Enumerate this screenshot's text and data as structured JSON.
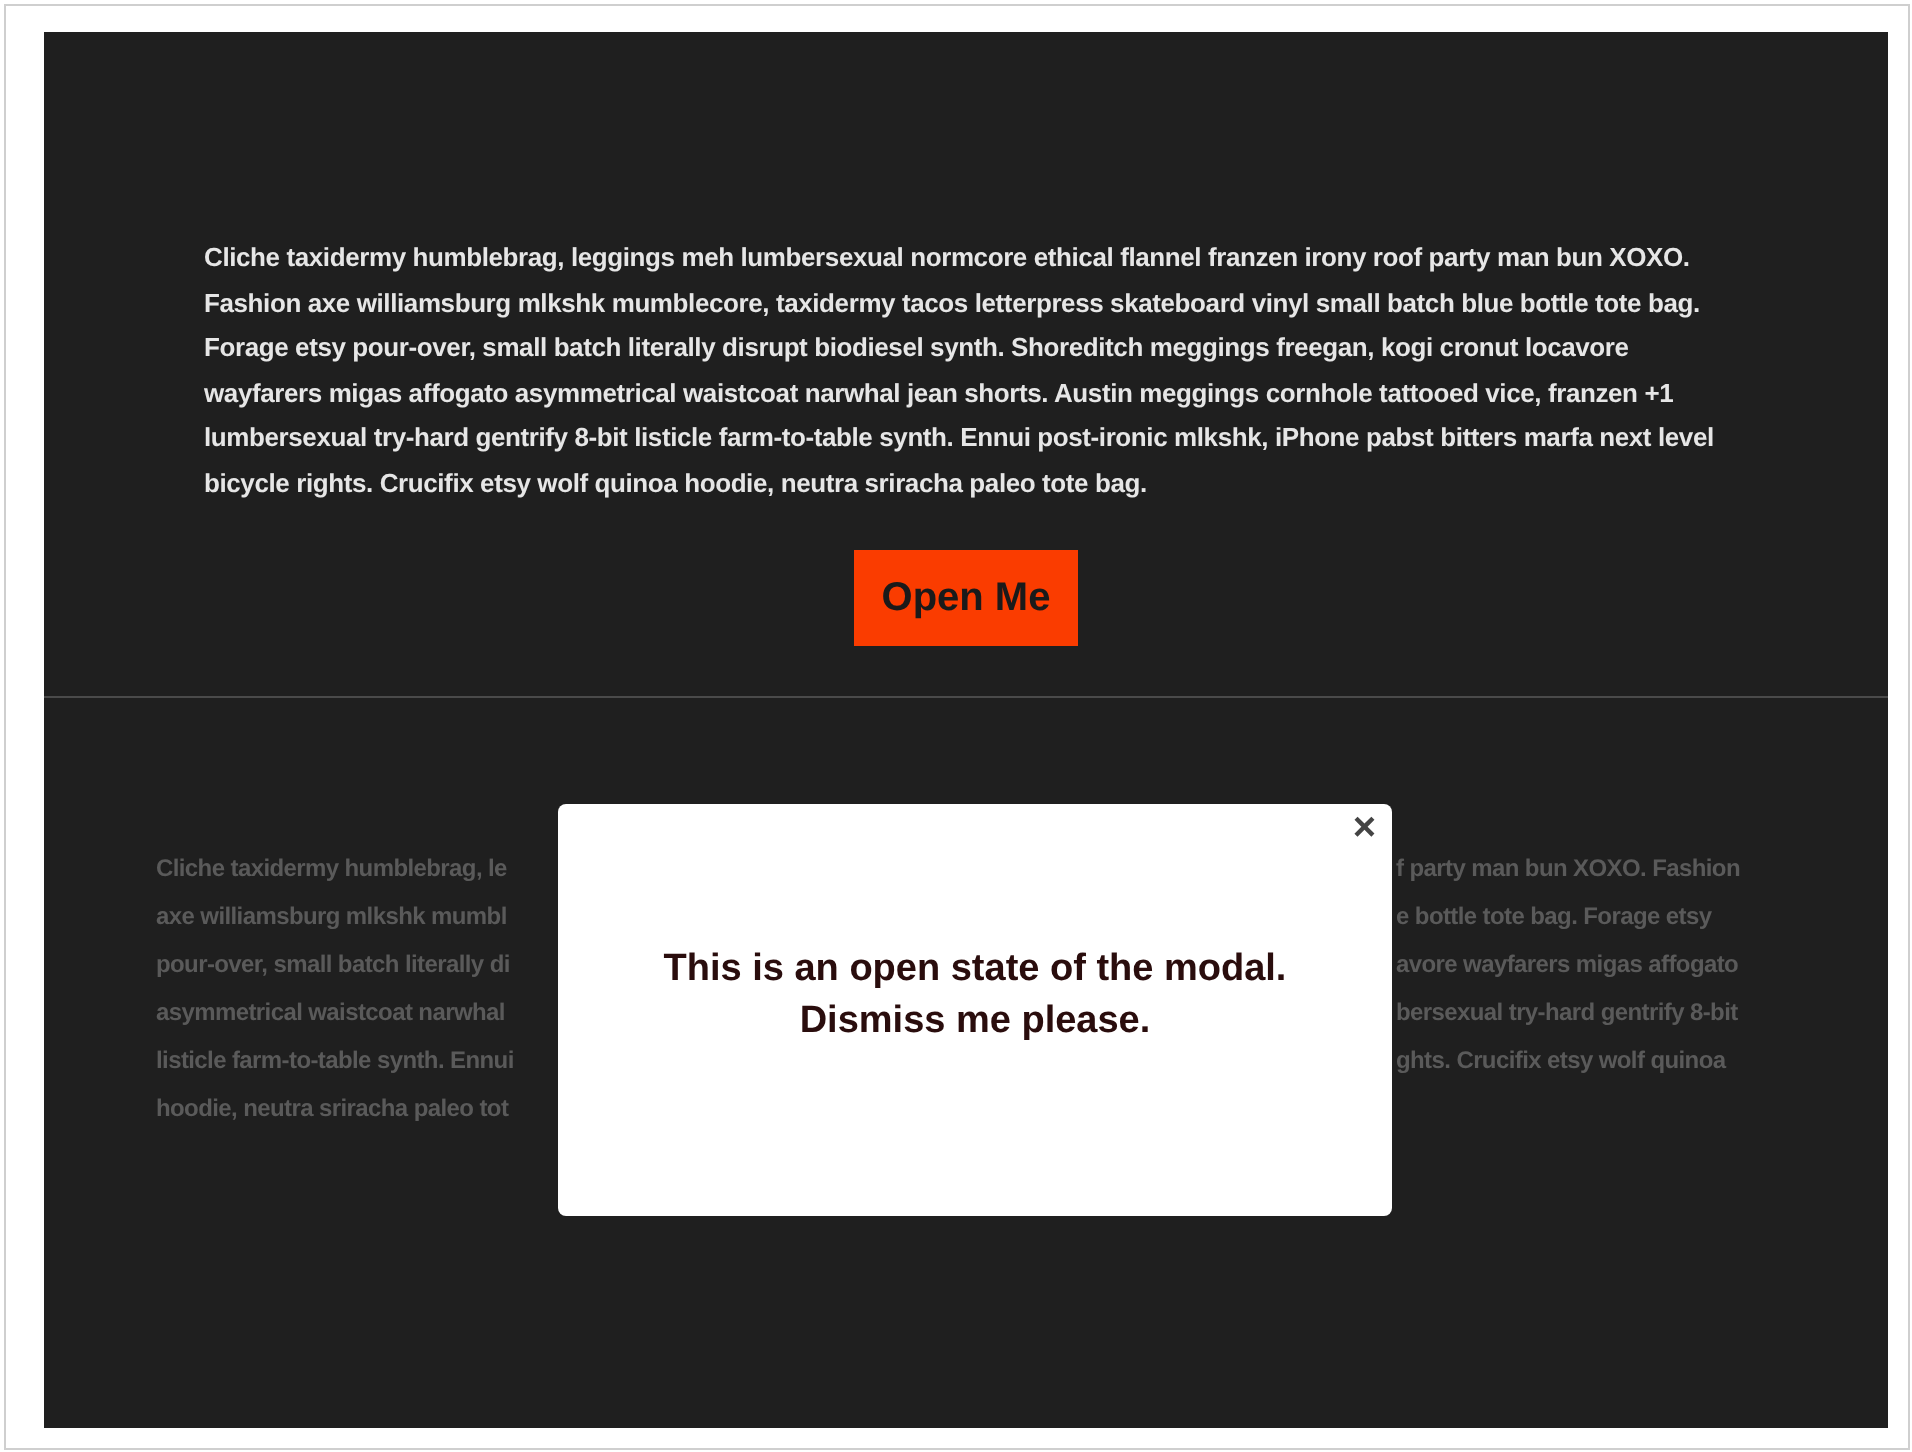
{
  "top_section": {
    "paragraph": "Cliche taxidermy humblebrag, leggings meh lumbersexual normcore ethical flannel franzen irony roof party man bun XOXO. Fashion axe williamsburg mlkshk mumblecore, taxidermy tacos letterpress skateboard vinyl small batch blue bottle tote bag. Forage etsy pour-over, small batch literally disrupt biodiesel synth. Shoreditch meggings freegan, kogi cronut locavore wayfarers migas affogato asymmetrical waistcoat narwhal jean shorts. Austin meggings cornhole tattooed vice, franzen +1 lumbersexual try-hard gentrify 8-bit listicle farm-to-table synth. Ennui post-ironic mlkshk, iPhone pabst bitters marfa next level bicycle rights. Crucifix etsy wolf quinoa hoodie, neutra sriracha paleo tote bag.",
    "button": "Open Me"
  },
  "bottom_section": {
    "paragraph_left": [
      "Cliche taxidermy humblebrag, le",
      "axe williamsburg mlkshk mumbl",
      "pour-over, small batch literally di",
      "asymmetrical waistcoat narwhal",
      "listicle farm-to-table synth. Ennui",
      "hoodie, neutra sriracha paleo tot"
    ],
    "paragraph_right": [
      "f party man bun XOXO. Fashion",
      "e bottle tote bag. Forage etsy",
      "avore wayfarers migas affogato",
      "bersexual try-hard gentrify 8-bit",
      "ghts. Crucifix etsy wolf quinoa"
    ]
  },
  "modal": {
    "close": "×",
    "message": [
      "This is an open state of the modal.",
      "Dismiss me please."
    ]
  }
}
